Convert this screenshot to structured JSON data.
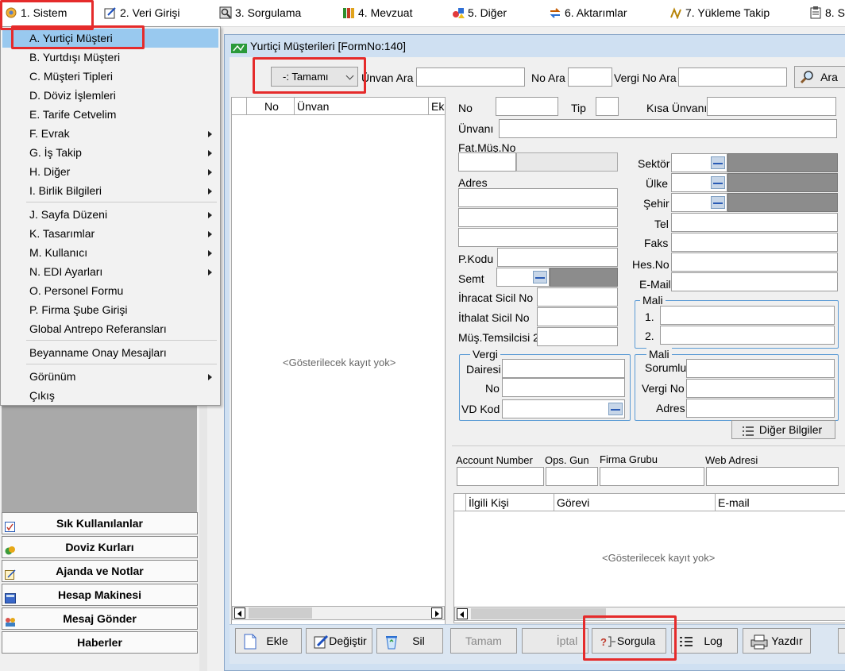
{
  "menu": {
    "items": [
      {
        "label": "1.  Sistem",
        "icon": "system-icon"
      },
      {
        "label": "2.  Veri Girişi",
        "icon": "edit-icon"
      },
      {
        "label": "3.  Sorgulama",
        "icon": "query-icon"
      },
      {
        "label": "4.  Mevzuat",
        "icon": "books-icon"
      },
      {
        "label": "5.  Diğer",
        "icon": "shapes-icon"
      },
      {
        "label": "6.  Aktarımlar",
        "icon": "transfer-icon"
      },
      {
        "label": "7.  Yükleme Takip",
        "icon": "tracking-icon"
      },
      {
        "label": "8. S",
        "icon": "clipboard-icon"
      }
    ]
  },
  "sistem_menu": {
    "items": [
      {
        "label": "A.  Yurtiçi Müşteri",
        "submenu": false,
        "selected": true
      },
      {
        "label": "B.  Yurtdışı Müşteri",
        "submenu": false
      },
      {
        "label": "C.  Müşteri Tipleri",
        "submenu": false
      },
      {
        "label": "D.  Döviz İşlemleri",
        "submenu": false
      },
      {
        "label": "E.  Tarife Cetvelim",
        "submenu": false
      },
      {
        "label": "F.  Evrak",
        "submenu": true
      },
      {
        "label": "G.  İş Takip",
        "submenu": true
      },
      {
        "label": "H.  Diğer",
        "submenu": true
      },
      {
        "label": "I.  Birlik Bilgileri",
        "submenu": true
      },
      {
        "label": "J.  Sayfa Düzeni",
        "submenu": true
      },
      {
        "label": "K.  Tasarımlar",
        "submenu": true
      },
      {
        "label": "M.  Kullanıcı",
        "submenu": true
      },
      {
        "label": "N.  EDI Ayarları",
        "submenu": true
      },
      {
        "label": "O.  Personel Formu",
        "submenu": false
      },
      {
        "label": "P.  Firma Şube Girişi",
        "submenu": false
      },
      {
        "label": "Global Antrepo Referansları",
        "submenu": false
      },
      {
        "label": "Beyanname Onay Mesajları",
        "submenu": false
      },
      {
        "label": "Görünüm",
        "submenu": true
      },
      {
        "label": "Çıkış",
        "submenu": false
      }
    ]
  },
  "sidebar": {
    "buttons": [
      {
        "label": "Sık Kullanılanlar",
        "icon": "favorites-icon"
      },
      {
        "label": "Doviz Kurları",
        "icon": "currency-icon"
      },
      {
        "label": "Ajanda ve Notlar",
        "icon": "notes-icon"
      },
      {
        "label": "Hesap Makinesi",
        "icon": "calculator-icon"
      },
      {
        "label": "Mesaj Gönder",
        "icon": "users-icon"
      },
      {
        "label": "Haberler",
        "icon": ""
      }
    ]
  },
  "form": {
    "title": "Yurtiçi Müşterileri [FormNo:140]",
    "filter_value": "-: Tamamı",
    "unvan_ara": "Ünvan Ara",
    "no_ara": "No Ara",
    "vergi_no_ara": "Vergi No Ara",
    "ara_button": "Ara",
    "list_headers": [
      "No",
      "Ünvan",
      "Ek"
    ],
    "empty_text": "<Gösterilecek kayıt yok>",
    "fields": {
      "no": "No",
      "tip": "Tip",
      "kisa_unvani": "Kısa Ünvanı",
      "unvani": "Ünvanı",
      "fat_mus_no": "Fat.Müş.No",
      "adres": "Adres",
      "sektor": "Sektör",
      "ulke": "Ülke",
      "sehir": "Şehir",
      "tel": "Tel",
      "faks": "Faks",
      "hes_no": "Hes.No",
      "pkodu": "P.Kodu",
      "semt": "Semt",
      "email": "E-Mail",
      "ihracat": "İhracat Sicil No",
      "ithalat": "İthalat Sicil No",
      "mus_temsilcisi": "Müş.Temsilcisi 2",
      "mali1": "Mali",
      "line1": "1.",
      "line2": "2.",
      "vergi_group": "Vergi",
      "dairesi": "Dairesi",
      "vergi_no_lbl": "No",
      "vd_kod": "VD Kod",
      "mali2": "Mali",
      "sorumlu": "Sorumlu",
      "vergi_no": "Vergi No",
      "adres2": "Adres",
      "diger_bilgiler": "Diğer Bilgiler",
      "account_number": "Account Number",
      "ops_gun": "Ops. Gun",
      "firma_grubu": "Firma Grubu",
      "web_adresi": "Web Adresi"
    },
    "contacts_headers": [
      "İlgili Kişi",
      "Görevi",
      "E-mail"
    ],
    "buttons": {
      "ekle": "Ekle",
      "degistir": "Değiştir",
      "sil": "Sil",
      "tamam": "Tamam",
      "iptal": "İptal",
      "sorgula": "Sorgula",
      "log": "Log",
      "yazdir": "Yazdır"
    }
  }
}
